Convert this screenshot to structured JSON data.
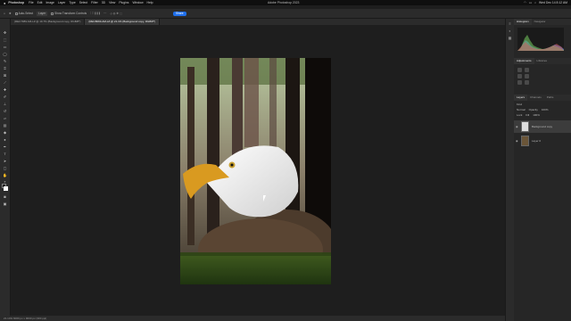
{
  "menubar": {
    "apple": "",
    "app": "Photoshop",
    "items": [
      "File",
      "Edit",
      "Image",
      "Layer",
      "Type",
      "Select",
      "Filter",
      "3D",
      "View",
      "Plugins",
      "Window",
      "Help"
    ],
    "window_title": "Adobe Photoshop 2023",
    "clock": "Wed Dec 14  8:12 AM"
  },
  "options": {
    "auto_select": "Auto-Select",
    "layer_dropdown": "Layer",
    "show_transform": "Show Transform Controls",
    "blue_btn": "Share"
  },
  "tabs": [
    {
      "label": "(REC7989 AM-L# @ 19.7% (Background copy, RGB/8*)"
    },
    {
      "label": "(REC8093-AM-L# @ 21.1% (Background copy, RGB/8*)"
    }
  ],
  "panels": {
    "top_tabs": [
      "Histogram",
      "Navigator"
    ],
    "adj_title": "Adjustments",
    "adj_tabs": [
      "Adjustments",
      "Libraries"
    ],
    "adj_add": "Add an adjustment",
    "layers_tabs": [
      "Layers",
      "Channels",
      "Paths"
    ],
    "layer_kind": "Kind",
    "blend_mode": "Normal",
    "opacity_label": "Opacity",
    "opacity": "100%",
    "lock_label": "Lock",
    "fill_label": "Fill",
    "fill": "100%",
    "layers": [
      {
        "name": "Background copy"
      },
      {
        "name": "Layer 0"
      }
    ]
  },
  "status": "21.14%    6000 px x 9000 px (300 ppi)",
  "colors": {
    "accent": "#1f6feb",
    "bg": "#1e1e1e",
    "panel": "#2b2b2b"
  }
}
